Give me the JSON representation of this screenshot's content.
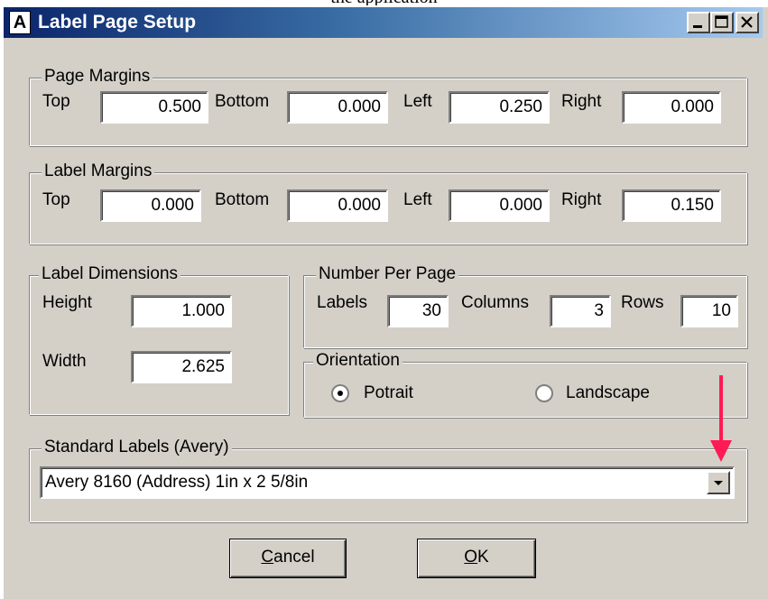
{
  "top_clip_text": "the application",
  "window": {
    "title": "Label Page Setup",
    "app_icon_letter": "A"
  },
  "page_margins": {
    "legend": "Page Margins",
    "top_label": "Top",
    "top_value": "0.500",
    "bottom_label": "Bottom",
    "bottom_value": "0.000",
    "left_label": "Left",
    "left_value": "0.250",
    "right_label": "Right",
    "right_value": "0.000"
  },
  "label_margins": {
    "legend": "Label Margins",
    "top_label": "Top",
    "top_value": "0.000",
    "bottom_label": "Bottom",
    "bottom_value": "0.000",
    "left_label": "Left",
    "left_value": "0.000",
    "right_label": "Right",
    "right_value": "0.150"
  },
  "label_dimensions": {
    "legend": "Label Dimensions",
    "height_label": "Height",
    "height_value": "1.000",
    "width_label": "Width",
    "width_value": "2.625"
  },
  "number_per_page": {
    "legend": "Number Per Page",
    "labels_label": "Labels",
    "labels_value": "30",
    "columns_label": "Columns",
    "columns_value": "3",
    "rows_label": "Rows",
    "rows_value": "10"
  },
  "orientation": {
    "legend": "Orientation",
    "portrait_label": "Potrait",
    "landscape_label": "Landscape",
    "selected": "portrait"
  },
  "standard_labels": {
    "legend": "Standard Labels (Avery)",
    "selected": "Avery 8160 (Address)  1in x 2 5/8in"
  },
  "buttons": {
    "cancel_rest": "ancel",
    "cancel_accel": "C",
    "ok_rest": "K",
    "ok_accel": "O"
  },
  "colors": {
    "dialog_bg": "#d4d0c8",
    "titlebar_start": "#0a246a",
    "titlebar_end": "#a6caf0",
    "annotation_arrow": "#ff1a55"
  }
}
